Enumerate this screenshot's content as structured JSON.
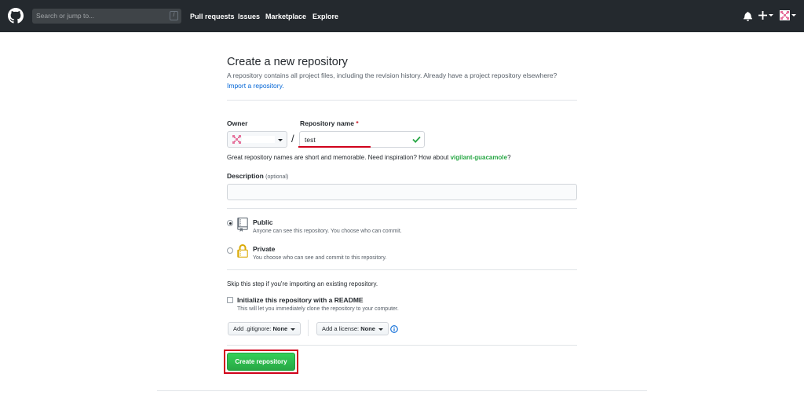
{
  "header": {
    "search_placeholder": "Search or jump to...",
    "search_shortcut": "/",
    "nav": [
      "Pull requests",
      "Issues",
      "Marketplace",
      "Explore"
    ],
    "icons": [
      "github-logo-icon",
      "bell-icon",
      "plus-icon",
      "avatar"
    ]
  },
  "form": {
    "title": "Create a new repository",
    "subtitle": "A repository contains all project files, including the revision history. Already have a project repository elsewhere?",
    "import_link": "Import a repository.",
    "owner_label": "Owner",
    "repo_label": "Repository name",
    "required_mark": "*",
    "separator": "/",
    "repo_value": "test",
    "hint_prefix": "Great repository names are short and memorable. Need inspiration? How about ",
    "hint_suggestion": "vigilant-guacamole",
    "hint_suffix": "?",
    "description_label": "Description",
    "description_optional": "(optional)",
    "description_value": "",
    "visibility": [
      {
        "label": "Public",
        "desc": "Anyone can see this repository. You choose who can commit.",
        "selected": true
      },
      {
        "label": "Private",
        "desc": "You choose who can see and commit to this repository.",
        "selected": false
      }
    ],
    "skip_text": "Skip this step if you're importing an existing repository.",
    "readme_label": "Initialize this repository with a README",
    "readme_desc": "This will let you immediately clone the repository to your computer.",
    "readme_checked": false,
    "gitignore_label": "Add .gitignore:",
    "gitignore_value": "None",
    "license_label": "Add a license:",
    "license_value": "None",
    "create_button": "Create repository"
  },
  "colors": {
    "header_bg": "#24292e",
    "primary_green": "#28a745",
    "link_blue": "#0366d6",
    "annotation_red": "#d0021b"
  }
}
